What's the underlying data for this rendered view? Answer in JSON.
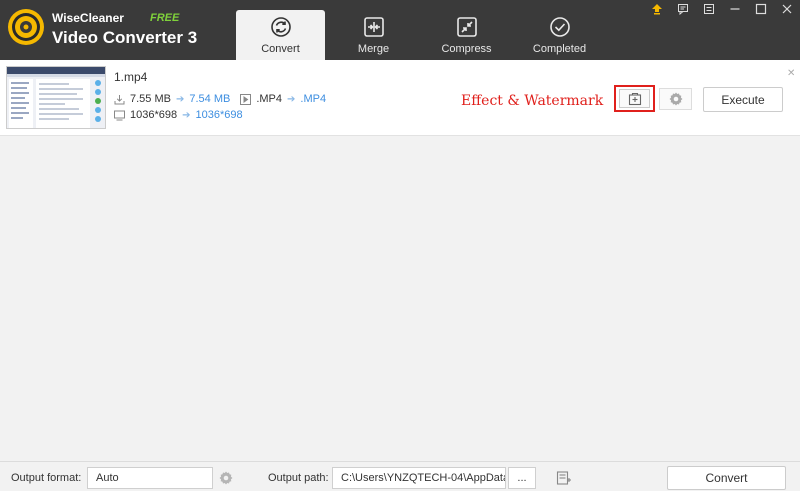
{
  "app": {
    "brand_small": "WiseCleaner",
    "brand_badge": "FREE",
    "brand_main": "Video Converter 3"
  },
  "tabs": [
    {
      "label": "Convert",
      "icon": "convert-icon",
      "active": true
    },
    {
      "label": "Merge",
      "icon": "merge-icon",
      "active": false
    },
    {
      "label": "Compress",
      "icon": "compress-icon",
      "active": false
    },
    {
      "label": "Completed",
      "icon": "completed-icon",
      "active": false
    }
  ],
  "window_controls": [
    "upgrade-icon",
    "feedback-icon",
    "menu-icon",
    "minimize-icon",
    "maximize-icon",
    "close-icon"
  ],
  "file": {
    "name": "1.mp4",
    "size_from": "7.55 MB",
    "size_to": "7.54 MB",
    "format_from": ".MP4",
    "format_to": ".MP4",
    "res_from": "1036*698",
    "res_to": "1036*698",
    "annotation": "Effect & Watermark",
    "execute_label": "Execute"
  },
  "bottom": {
    "output_format_label": "Output format:",
    "output_format_value": "Auto",
    "output_path_label": "Output path:",
    "output_path_value": "C:\\Users\\YNZQTECH-04\\AppData...",
    "browse_label": "...",
    "convert_label": "Convert"
  },
  "colors": {
    "titlebar": "#3a3a3a",
    "accent_blue": "#3d8ee0",
    "annotation_red": "#e0201c",
    "free_green": "#7fd13b",
    "content_bg": "#f2f2f2"
  }
}
